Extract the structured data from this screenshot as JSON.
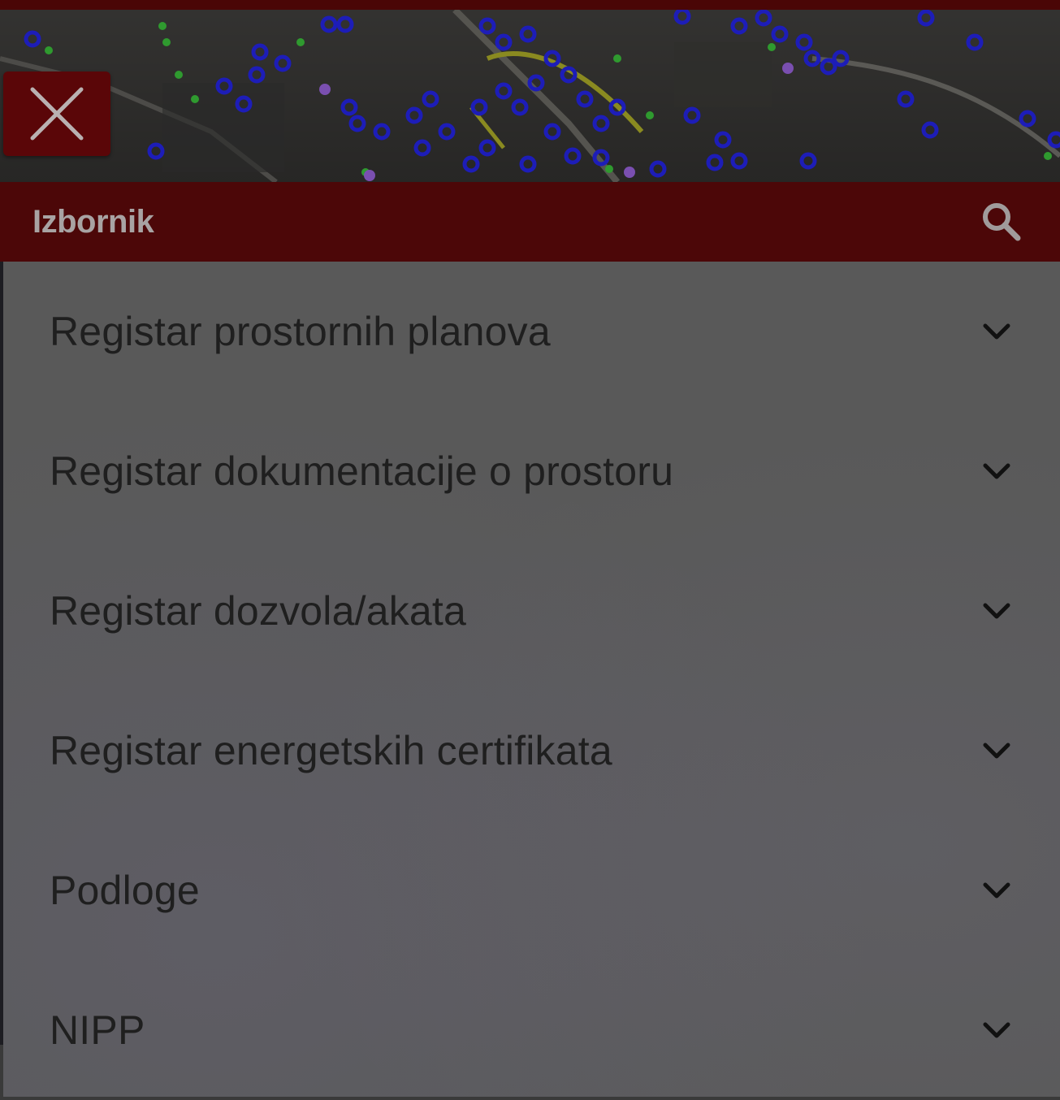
{
  "header": {
    "title": "Izbornik",
    "search_icon": "search-icon",
    "close_icon": "close-icon",
    "colors": {
      "header_bg": "#4c0708",
      "close_bg": "#5a0608",
      "title_color": "#a8a3a3"
    }
  },
  "menu": {
    "items": [
      {
        "label": "Registar prostornih planova",
        "icon": "chevron-down-icon"
      },
      {
        "label": "Registar dokumentacije o prostoru",
        "icon": "chevron-down-icon"
      },
      {
        "label": "Registar dozvola/akata",
        "icon": "chevron-down-icon"
      },
      {
        "label": "Registar energetskih certifikata",
        "icon": "chevron-down-icon"
      },
      {
        "label": "Podloge",
        "icon": "chevron-down-icon"
      },
      {
        "label": "NIPP",
        "icon": "chevron-down-icon"
      }
    ]
  }
}
